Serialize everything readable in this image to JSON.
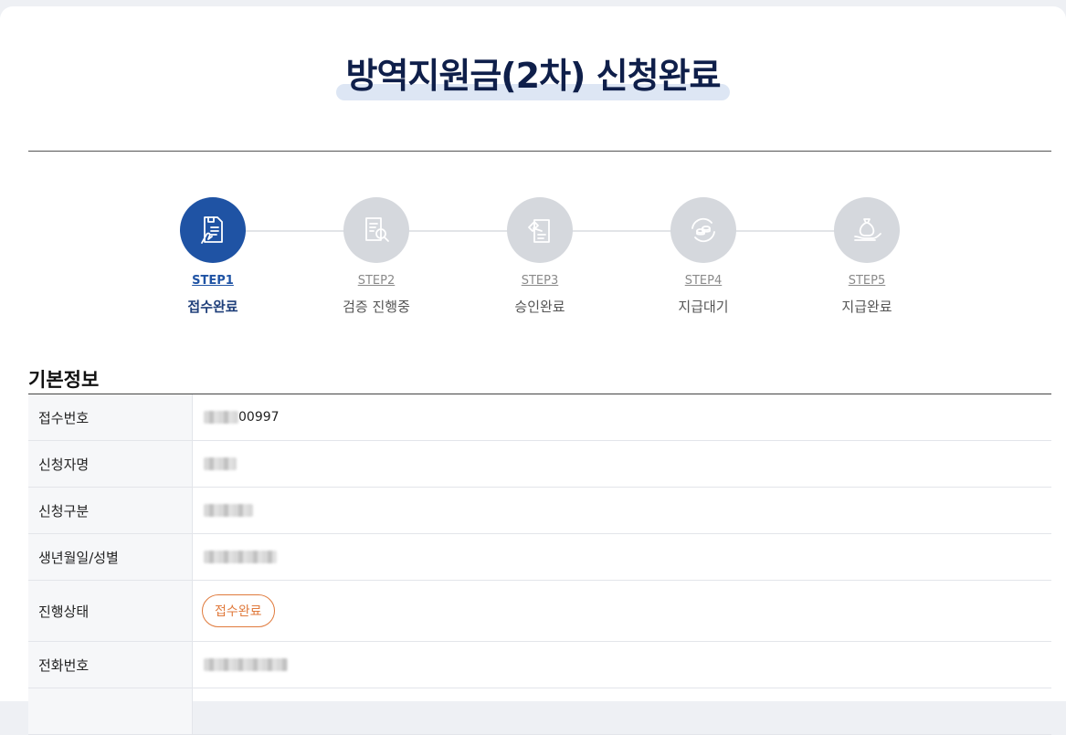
{
  "page": {
    "title": "방역지원금(2차) 신청완료"
  },
  "steps": [
    {
      "num": "STEP1",
      "label": "접수완료",
      "icon": "document-hand-icon",
      "active": true
    },
    {
      "num": "STEP2",
      "label": "검증 진행중",
      "icon": "document-search-icon",
      "active": false
    },
    {
      "num": "STEP3",
      "label": "승인완료",
      "icon": "approval-gavel-icon",
      "active": false
    },
    {
      "num": "STEP4",
      "label": "지급대기",
      "icon": "coins-cycle-icon",
      "active": false
    },
    {
      "num": "STEP5",
      "label": "지급완료",
      "icon": "money-bag-hand-icon",
      "active": false
    }
  ],
  "basic_info": {
    "title": "기본정보",
    "rows": [
      {
        "label": "접수번호",
        "value_visible": "00997"
      },
      {
        "label": "신청자명"
      },
      {
        "label": "신청구분"
      },
      {
        "label": "생년월일/성별"
      },
      {
        "label": "진행상태",
        "badge": "접수완료"
      },
      {
        "label": "전화번호"
      }
    ]
  },
  "colors": {
    "accent": "#1f53a4",
    "title": "#0f1f4a",
    "badge": "#e07a3c",
    "step_inactive": "#d5d8dd"
  }
}
